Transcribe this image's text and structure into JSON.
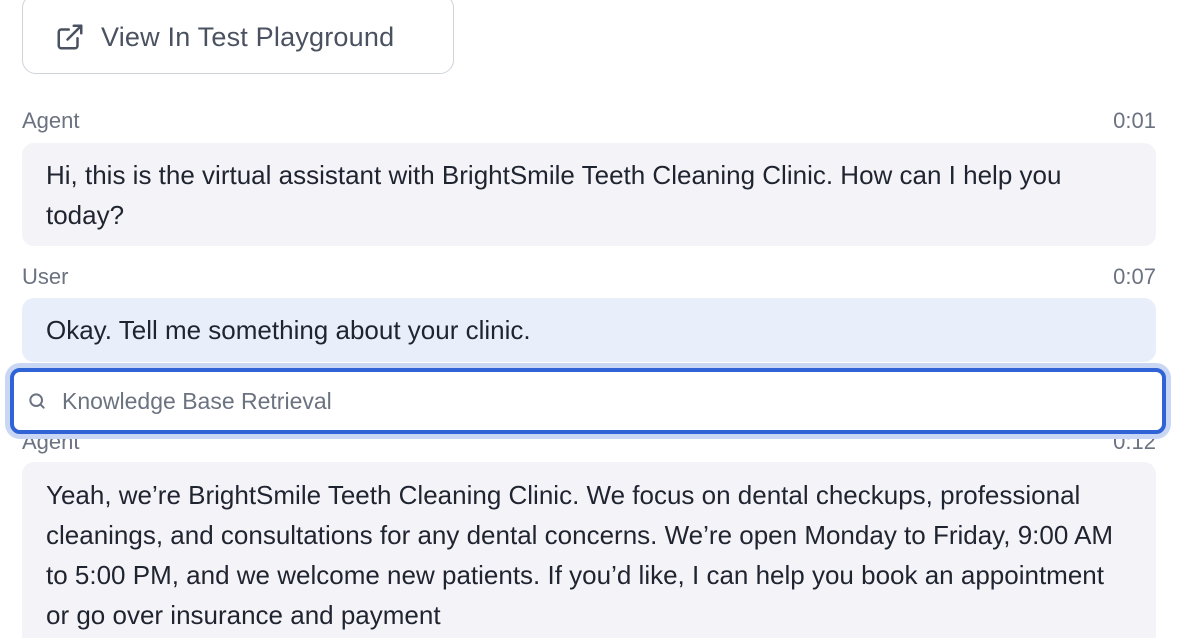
{
  "toolbar": {
    "playground_label": "View In Test Playground"
  },
  "icons": {
    "external_link": "external-link-icon",
    "search": "search-icon"
  },
  "colors": {
    "agent_bubble": "#f4f4f8",
    "user_bubble": "#e9eefb",
    "highlight_border": "#2f63d6"
  },
  "messages": [
    {
      "role": "Agent",
      "time": "0:01",
      "text": "Hi, this is the virtual assistant with BrightSmile Teeth Cleaning Clinic. How can I help you today?"
    },
    {
      "role": "User",
      "time": "0:07",
      "text": "Okay. Tell me something about your clinic."
    },
    {
      "role": "Agent",
      "time": "0:12",
      "text": "Yeah, we’re BrightSmile Teeth Cleaning Clinic. We focus on dental checkups, professional cleanings, and consultations for any dental concerns. We’re open Monday to Friday, 9:00 AM to 5:00 PM, and we welcome new patients. If you’d like, I can help you book an appointment or go over insurance and payment"
    }
  ],
  "tool_call": {
    "label": "Knowledge Base Retrieval"
  }
}
